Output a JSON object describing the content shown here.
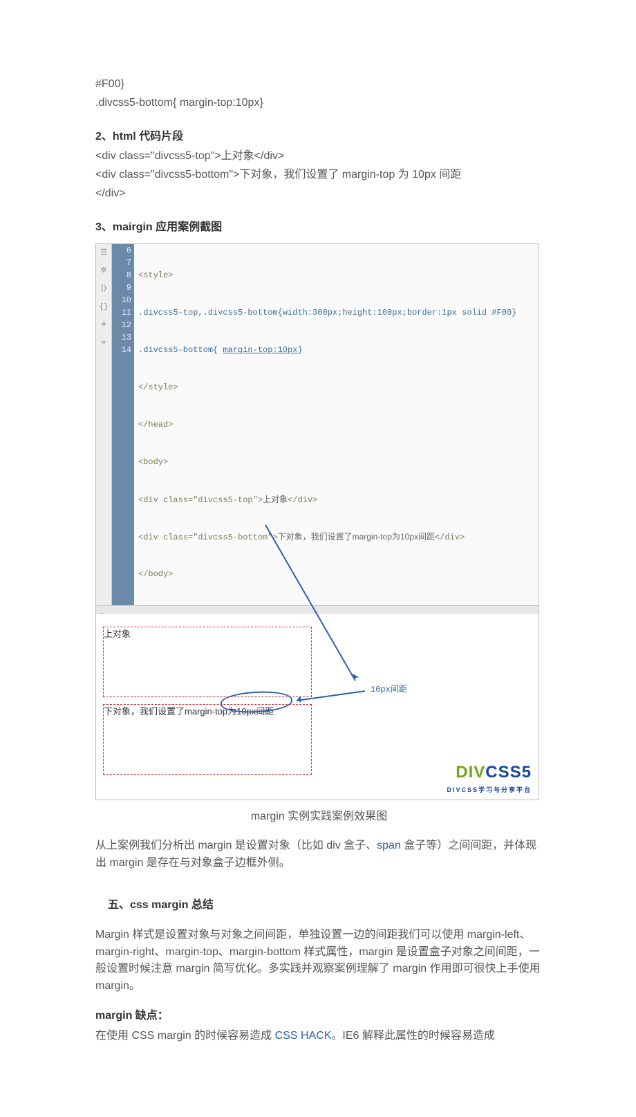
{
  "code_snippet_top": {
    "line1": "#F00}",
    "line2": ".divcss5-bottom{ margin-top:10px}"
  },
  "sec2": {
    "num": "2、",
    "title_b": "html",
    "title_rest": " 代码片段",
    "line1": "<div class=\"divcss5-top\">上对象</div>",
    "line2_a": "<div class=\"divcss5-bottom\">下对象，我们设置了 margin-top 为 10px 间距",
    "line2_b": "</div>"
  },
  "sec3": {
    "num": "3、",
    "title_b": "mairgin",
    "title_rest": " 应用案例截图"
  },
  "editor": {
    "lines": [
      "6",
      "7",
      "8",
      "9",
      "10",
      "11",
      "12",
      "13",
      "14"
    ],
    "code": {
      "l6": "<style>",
      "l7": ".divcss5-top,.divcss5-bottom{width:300px;height:100px;border:1px solid #F00}",
      "l8_a": ".divcss5-bottom{ ",
      "l8_b": "margin-top:10px",
      "l8_c": "}",
      "l9": "</style>",
      "l10": "</head>",
      "l11": "<body>",
      "l12_a": "<div class=\"divcss5-top\">",
      "l12_b": "上对象",
      "l12_c": "</div>",
      "l13_a": "<div class=\"divcss5-bottom\">",
      "l13_b": "下对象，我们设置了margin-top为10px间距",
      "l13_c": "</div>",
      "l14": "</body>"
    }
  },
  "preview": {
    "top_label": "上对象",
    "bottom_label": "下对象，我们设置了margin-top为10px间距",
    "gap_label": "10px间距"
  },
  "logo": {
    "div": "DIV",
    "css5": "CSS5",
    "sub": "DIVCSS学习与分享平台"
  },
  "caption": "margin 实例实践案例效果图",
  "para_after_fig_a": "从上案例我们分析出 margin 是设置对象（比如 div 盒子、",
  "para_after_fig_link": "span",
  "para_after_fig_b": " 盒子等）之间间距，并体现出 margin 是存在与对象盒子边框外侧。",
  "sec5_title": "五、css margin 总结",
  "sec5_body": "Margin 样式是设置对象与对象之间间距，单独设置一边的间距我们可以使用 margin-left、margin-right、margin-top、margin-bottom 样式属性，margin 是设置盒子对象之间间距，一般设置时候注意 margin 简写优化。多实践并观察案例理解了 margin 作用即可很快上手使用 margin。",
  "margin_caveat": {
    "title": "margin 缺点：",
    "body_a": "在使用 CSS margin 的时候容易造成 ",
    "link": "CSS HACK",
    "body_b": "。IE6 解释此属性的时候容易造成"
  }
}
